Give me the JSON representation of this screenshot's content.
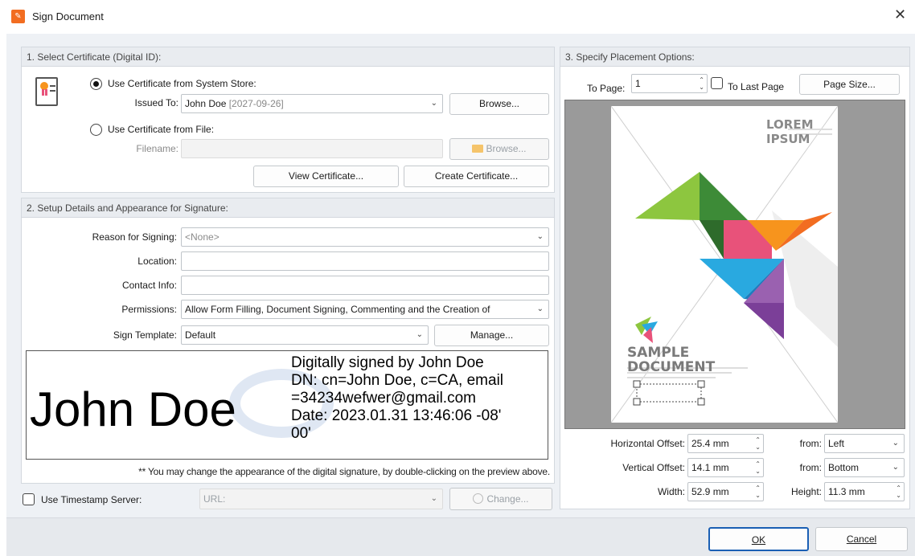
{
  "window": {
    "title": "Sign Document",
    "close_glyph": "✕"
  },
  "section1": {
    "title": "1. Select Certificate (Digital ID):",
    "radio_system": "Use Certificate from System Store:",
    "issued_to_label": "Issued To:",
    "issued_to_value": "John Doe",
    "issued_to_date": "[2027-09-26]",
    "browse1": "Browse...",
    "radio_file": "Use Certificate from File:",
    "filename_label": "Filename:",
    "filename_value": "",
    "browse2": "Browse...",
    "view_cert": "View Certificate...",
    "create_cert": "Create Certificate..."
  },
  "section2": {
    "title": "2. Setup Details and Appearance for Signature:",
    "reason_label": "Reason for Signing:",
    "reason_value": "<None>",
    "location_label": "Location:",
    "location_value": "",
    "contact_label": "Contact Info:",
    "contact_value": "",
    "permissions_label": "Permissions:",
    "permissions_value": "Allow Form Filling, Document Signing, Commenting and the Creation of",
    "template_label": "Sign Template:",
    "template_value": "Default",
    "manage": "Manage...",
    "sig_name": "John Doe",
    "sig_line1": "Digitally signed by John Doe",
    "sig_line2": "DN: cn=John Doe, c=CA, email",
    "sig_line3": "=34234wefwer@gmail.com",
    "sig_line4": "Date: 2023.01.31 13:46:06 -08'",
    "sig_line5": "00'",
    "hint": "** You may change the appearance of the digital signature, by double-clicking on the preview above."
  },
  "timestamp": {
    "label": "Use Timestamp Server:",
    "url_placeholder": "URL:",
    "change": "Change..."
  },
  "section3": {
    "title": "3. Specify Placement Options:",
    "to_page_label": "To Page:",
    "to_page_value": "1",
    "to_last_page": "To Last Page",
    "page_size": "Page Size...",
    "preview": {
      "lorem": "LOREM IPSUM",
      "sample": "SAMPLE",
      "document": "DOCUMENT"
    },
    "h_offset_label": "Horizontal Offset:",
    "h_offset_value": "25.4 mm",
    "v_offset_label": "Vertical Offset:",
    "v_offset_value": "14.1 mm",
    "width_label": "Width:",
    "width_value": "52.9 mm",
    "from_label_1": "from:",
    "from_value_1": "Left",
    "from_label_2": "from:",
    "from_value_2": "Bottom",
    "height_label": "Height:",
    "height_value": "11.3 mm"
  },
  "footer": {
    "ok": "OK",
    "cancel": "Cancel"
  },
  "colors": {
    "accent": "#f26d21",
    "triangle_green": "#8dc63f",
    "triangle_darkgreen": "#3d8b37",
    "triangle_pink": "#e8527a",
    "triangle_orange": "#f7941d",
    "triangle_blue": "#29a9e0",
    "triangle_purple": "#7b3f98"
  }
}
